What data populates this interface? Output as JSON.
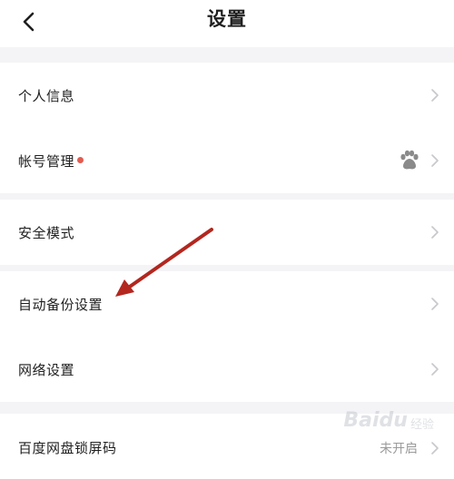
{
  "header": {
    "title": "设置"
  },
  "groups": [
    {
      "items": [
        {
          "label": "个人信息"
        },
        {
          "label": "帐号管理",
          "badge_color": "#e25c52"
        }
      ]
    },
    {
      "items": [
        {
          "label": "安全模式"
        }
      ]
    },
    {
      "items": [
        {
          "label": "自动备份设置"
        },
        {
          "label": "网络设置"
        }
      ]
    },
    {
      "items": [
        {
          "label": "百度网盘锁屏码",
          "value": "未开启"
        }
      ]
    }
  ],
  "icons": {
    "back": "chevron-left-icon",
    "row_arrow": "chevron-right-icon",
    "account_avatar": "paw-icon"
  },
  "colors": {
    "annotation_arrow": "#b3271f",
    "background": "#f4f4f6"
  },
  "watermark": {
    "text": "Baidu",
    "sub": "经验"
  }
}
